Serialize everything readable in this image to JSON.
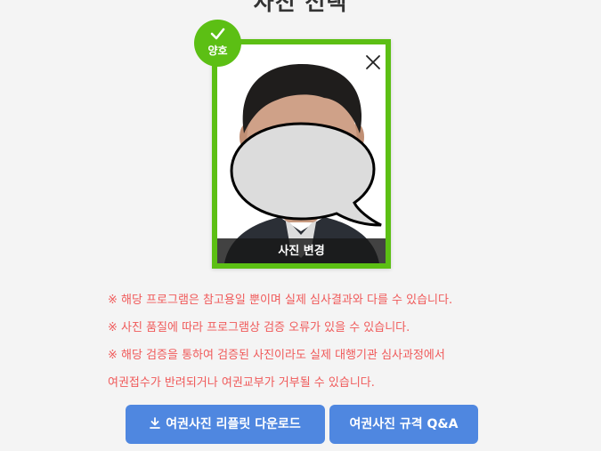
{
  "page": {
    "title": "사진 선택"
  },
  "photo": {
    "status_label": "양호",
    "change_label": "사진 변경",
    "close_icon": "close-icon",
    "check_icon": "check-icon",
    "frame_color": "#5cbf14"
  },
  "notices": [
    "※ 해당 프로그램은 참고용일 뿐이며 실제 심사결과와 다를 수 있습니다.",
    "※ 사진 품질에 따라 프로그램상 검증 오류가 있을 수 있습니다.",
    "※ 해당 검증을 통하여 검증된 사진이라도 실제 대행기관 심사과정에서",
    "여권접수가 반려되거나 여권교부가 거부될 수 있습니다."
  ],
  "buttons": {
    "download_label": "여권사진 리플릿 다운로드",
    "download_icon": "download-icon",
    "qa_label": "여권사진 규격 Q&A",
    "color": "#4f87e0"
  },
  "colors": {
    "notice_text": "#f05a5a",
    "background": "#f4f4f4"
  }
}
